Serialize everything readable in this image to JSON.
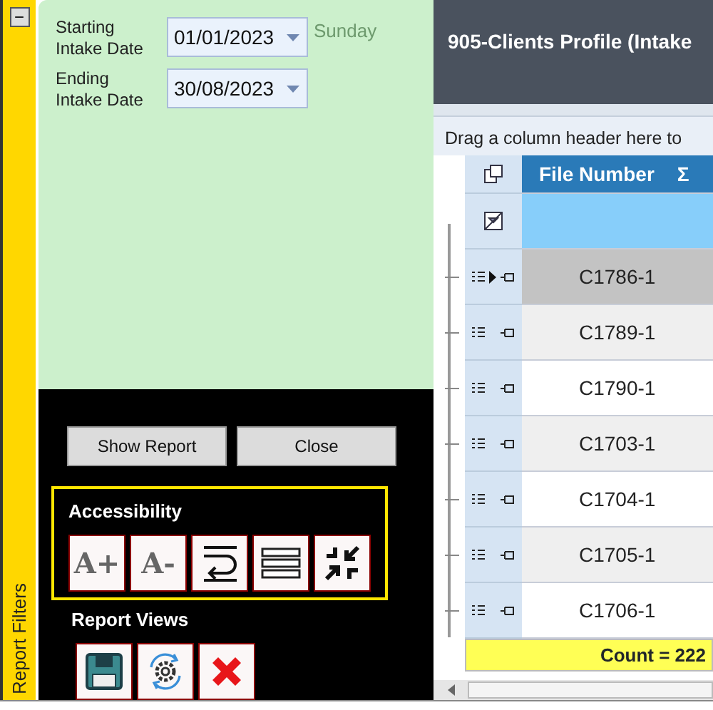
{
  "sidebar": {
    "collapse_button": "−",
    "label": "Report Filters"
  },
  "filters": [
    {
      "label": "Starting Intake Date",
      "value": "01/01/2023",
      "weekday": "Sunday"
    },
    {
      "label": "Ending Intake Date",
      "value": "30/08/2023"
    }
  ],
  "actions": [
    "Show Report",
    "Close"
  ],
  "accessibility": {
    "title": "Accessibility",
    "buttons": [
      {
        "kind": "text",
        "label": "A+"
      },
      {
        "kind": "text",
        "label": "A-"
      },
      {
        "kind": "wrap"
      },
      {
        "kind": "lines"
      },
      {
        "kind": "shrink"
      }
    ]
  },
  "report_views": {
    "title": "Report Views",
    "buttons": [
      {
        "kind": "save"
      },
      {
        "kind": "settings"
      },
      {
        "kind": "delete"
      }
    ]
  },
  "report": {
    "title": "905-Clients Profile (Intake",
    "group_hint": "Drag a column header here to",
    "columns": [
      {
        "label": "File Number",
        "summary": "Σ"
      }
    ],
    "rows": [
      {
        "file_number": "C1786-1",
        "selected": true
      },
      {
        "file_number": "C1789-1",
        "selected": false
      },
      {
        "file_number": "C1790-1",
        "selected": false
      },
      {
        "file_number": "C1703-1",
        "selected": false
      },
      {
        "file_number": "C1704-1",
        "selected": false
      },
      {
        "file_number": "C1705-1",
        "selected": false
      },
      {
        "file_number": "C1706-1",
        "selected": false
      }
    ],
    "footer": "Count = 222"
  }
}
